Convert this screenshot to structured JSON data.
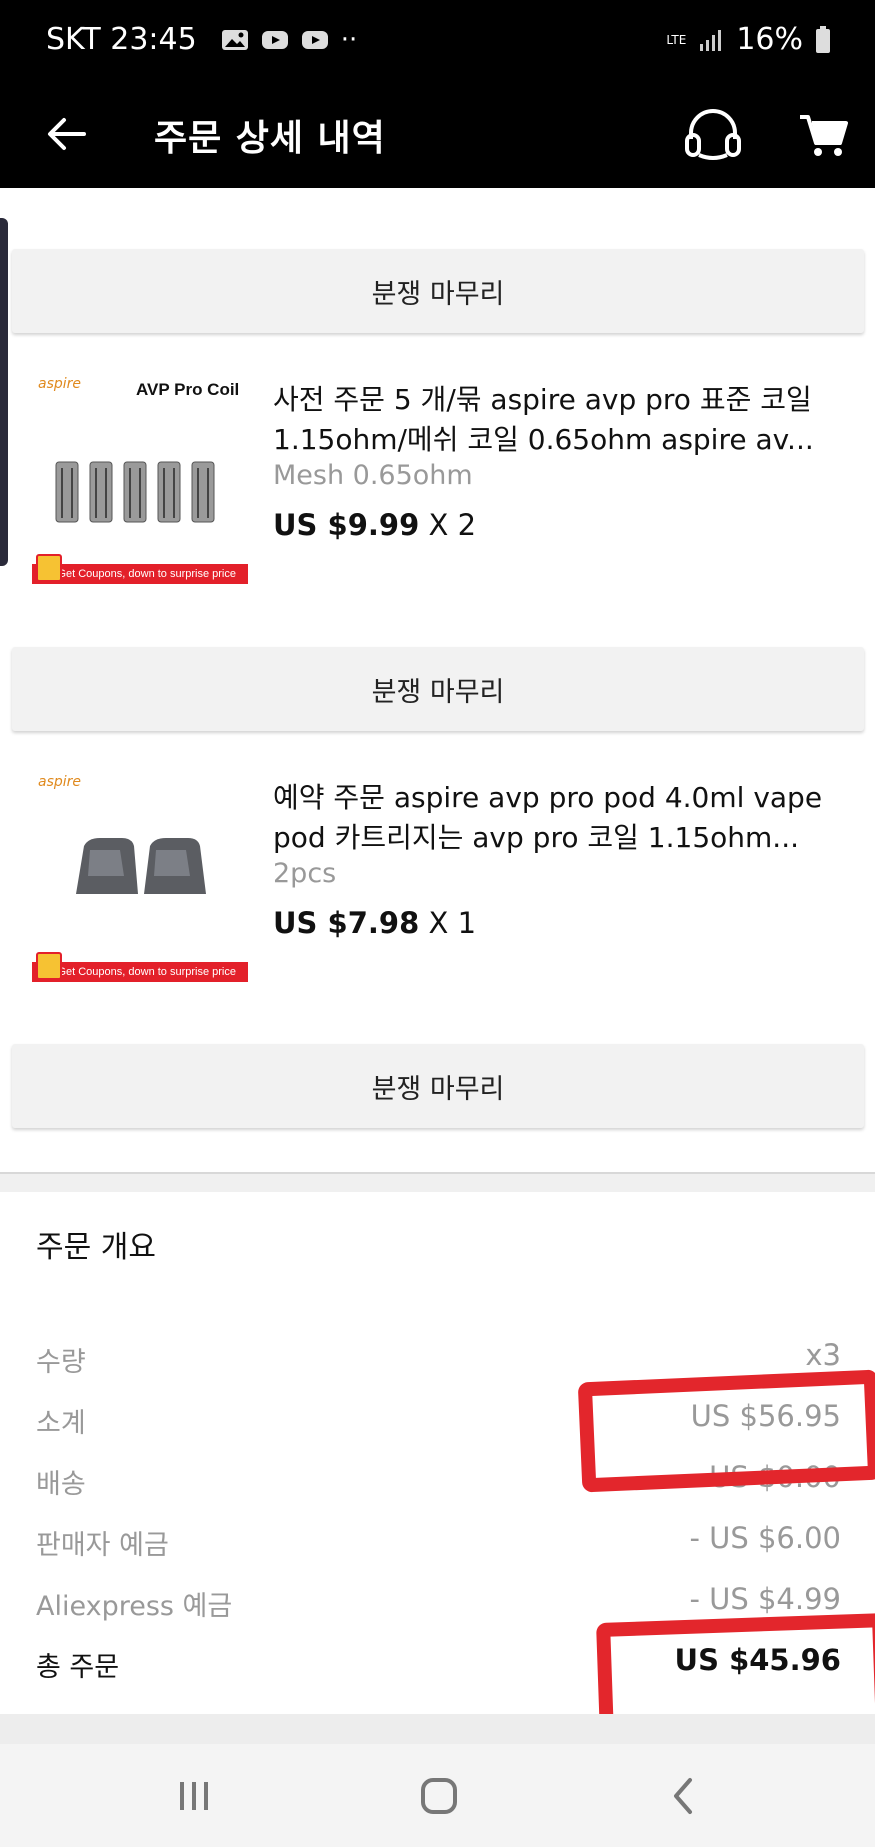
{
  "status_bar": {
    "carrier_time": "SKT 23:45",
    "extra_dots": "··",
    "network": "LTE",
    "battery": "16%"
  },
  "header": {
    "title": "주문 상세 내역",
    "icons": [
      "back-arrow-icon",
      "headset-icon",
      "cart-icon"
    ]
  },
  "dispute_label": "분쟁 마무리",
  "products": [
    {
      "thumb_brand": "aspire",
      "thumb_title": "AVP Pro Coil",
      "thumb_coupon": "Get Coupons, down to surprise price",
      "title_line1": "사전 주문 5 개/묶 aspire avp pro 표준 코일",
      "title_line2": "1.15ohm/메쉬 코일 0.65ohm aspire av...",
      "variant": "Mesh 0.65ohm",
      "price": "US $9.99",
      "qty": "X 2"
    },
    {
      "thumb_brand": "aspire",
      "thumb_title": "",
      "thumb_coupon": "Get Coupons, down to surprise price",
      "title_line1": "예약 주문 aspire avp pro pod 4.0ml vape",
      "title_line2": "pod 카트리지는 avp pro 코일 1.15ohm...",
      "variant": "2pcs",
      "price": "US $7.98",
      "qty": "X 1"
    }
  ],
  "summary": {
    "title": "주문 개요",
    "rows": [
      {
        "label": "수량",
        "value": "x3"
      },
      {
        "label": "소계",
        "value": "US $56.95"
      },
      {
        "label": "배송",
        "value": "US $0.00"
      },
      {
        "label": "판매자 예금",
        "value": "- US $6.00"
      },
      {
        "label": "Aliexpress 예금",
        "value": "- US $4.99"
      },
      {
        "label": "총 주문",
        "value": "US $45.96"
      }
    ]
  },
  "colors": {
    "header_bg": "#000000",
    "annotation_red": "#e3262c",
    "coupon_red": "#e3202a",
    "muted_text": "#999999"
  }
}
